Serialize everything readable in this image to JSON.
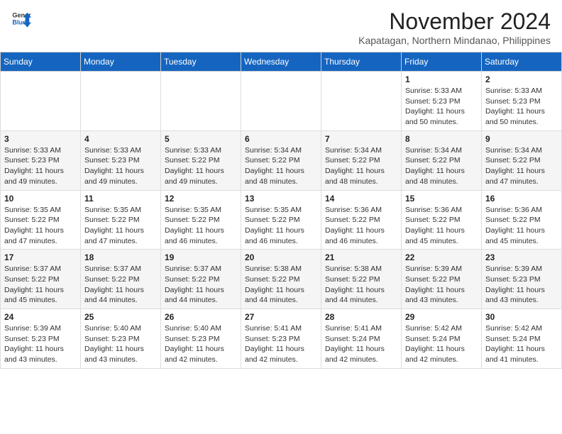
{
  "header": {
    "logo_line1": "General",
    "logo_line2": "Blue",
    "month": "November 2024",
    "location": "Kapatagan, Northern Mindanao, Philippines"
  },
  "weekdays": [
    "Sunday",
    "Monday",
    "Tuesday",
    "Wednesday",
    "Thursday",
    "Friday",
    "Saturday"
  ],
  "weeks": [
    [
      {
        "day": "",
        "info": ""
      },
      {
        "day": "",
        "info": ""
      },
      {
        "day": "",
        "info": ""
      },
      {
        "day": "",
        "info": ""
      },
      {
        "day": "",
        "info": ""
      },
      {
        "day": "1",
        "info": "Sunrise: 5:33 AM\nSunset: 5:23 PM\nDaylight: 11 hours\nand 50 minutes."
      },
      {
        "day": "2",
        "info": "Sunrise: 5:33 AM\nSunset: 5:23 PM\nDaylight: 11 hours\nand 50 minutes."
      }
    ],
    [
      {
        "day": "3",
        "info": "Sunrise: 5:33 AM\nSunset: 5:23 PM\nDaylight: 11 hours\nand 49 minutes."
      },
      {
        "day": "4",
        "info": "Sunrise: 5:33 AM\nSunset: 5:23 PM\nDaylight: 11 hours\nand 49 minutes."
      },
      {
        "day": "5",
        "info": "Sunrise: 5:33 AM\nSunset: 5:22 PM\nDaylight: 11 hours\nand 49 minutes."
      },
      {
        "day": "6",
        "info": "Sunrise: 5:34 AM\nSunset: 5:22 PM\nDaylight: 11 hours\nand 48 minutes."
      },
      {
        "day": "7",
        "info": "Sunrise: 5:34 AM\nSunset: 5:22 PM\nDaylight: 11 hours\nand 48 minutes."
      },
      {
        "day": "8",
        "info": "Sunrise: 5:34 AM\nSunset: 5:22 PM\nDaylight: 11 hours\nand 48 minutes."
      },
      {
        "day": "9",
        "info": "Sunrise: 5:34 AM\nSunset: 5:22 PM\nDaylight: 11 hours\nand 47 minutes."
      }
    ],
    [
      {
        "day": "10",
        "info": "Sunrise: 5:35 AM\nSunset: 5:22 PM\nDaylight: 11 hours\nand 47 minutes."
      },
      {
        "day": "11",
        "info": "Sunrise: 5:35 AM\nSunset: 5:22 PM\nDaylight: 11 hours\nand 47 minutes."
      },
      {
        "day": "12",
        "info": "Sunrise: 5:35 AM\nSunset: 5:22 PM\nDaylight: 11 hours\nand 46 minutes."
      },
      {
        "day": "13",
        "info": "Sunrise: 5:35 AM\nSunset: 5:22 PM\nDaylight: 11 hours\nand 46 minutes."
      },
      {
        "day": "14",
        "info": "Sunrise: 5:36 AM\nSunset: 5:22 PM\nDaylight: 11 hours\nand 46 minutes."
      },
      {
        "day": "15",
        "info": "Sunrise: 5:36 AM\nSunset: 5:22 PM\nDaylight: 11 hours\nand 45 minutes."
      },
      {
        "day": "16",
        "info": "Sunrise: 5:36 AM\nSunset: 5:22 PM\nDaylight: 11 hours\nand 45 minutes."
      }
    ],
    [
      {
        "day": "17",
        "info": "Sunrise: 5:37 AM\nSunset: 5:22 PM\nDaylight: 11 hours\nand 45 minutes."
      },
      {
        "day": "18",
        "info": "Sunrise: 5:37 AM\nSunset: 5:22 PM\nDaylight: 11 hours\nand 44 minutes."
      },
      {
        "day": "19",
        "info": "Sunrise: 5:37 AM\nSunset: 5:22 PM\nDaylight: 11 hours\nand 44 minutes."
      },
      {
        "day": "20",
        "info": "Sunrise: 5:38 AM\nSunset: 5:22 PM\nDaylight: 11 hours\nand 44 minutes."
      },
      {
        "day": "21",
        "info": "Sunrise: 5:38 AM\nSunset: 5:22 PM\nDaylight: 11 hours\nand 44 minutes."
      },
      {
        "day": "22",
        "info": "Sunrise: 5:39 AM\nSunset: 5:22 PM\nDaylight: 11 hours\nand 43 minutes."
      },
      {
        "day": "23",
        "info": "Sunrise: 5:39 AM\nSunset: 5:23 PM\nDaylight: 11 hours\nand 43 minutes."
      }
    ],
    [
      {
        "day": "24",
        "info": "Sunrise: 5:39 AM\nSunset: 5:23 PM\nDaylight: 11 hours\nand 43 minutes."
      },
      {
        "day": "25",
        "info": "Sunrise: 5:40 AM\nSunset: 5:23 PM\nDaylight: 11 hours\nand 43 minutes."
      },
      {
        "day": "26",
        "info": "Sunrise: 5:40 AM\nSunset: 5:23 PM\nDaylight: 11 hours\nand 42 minutes."
      },
      {
        "day": "27",
        "info": "Sunrise: 5:41 AM\nSunset: 5:23 PM\nDaylight: 11 hours\nand 42 minutes."
      },
      {
        "day": "28",
        "info": "Sunrise: 5:41 AM\nSunset: 5:24 PM\nDaylight: 11 hours\nand 42 minutes."
      },
      {
        "day": "29",
        "info": "Sunrise: 5:42 AM\nSunset: 5:24 PM\nDaylight: 11 hours\nand 42 minutes."
      },
      {
        "day": "30",
        "info": "Sunrise: 5:42 AM\nSunset: 5:24 PM\nDaylight: 11 hours\nand 41 minutes."
      }
    ]
  ]
}
